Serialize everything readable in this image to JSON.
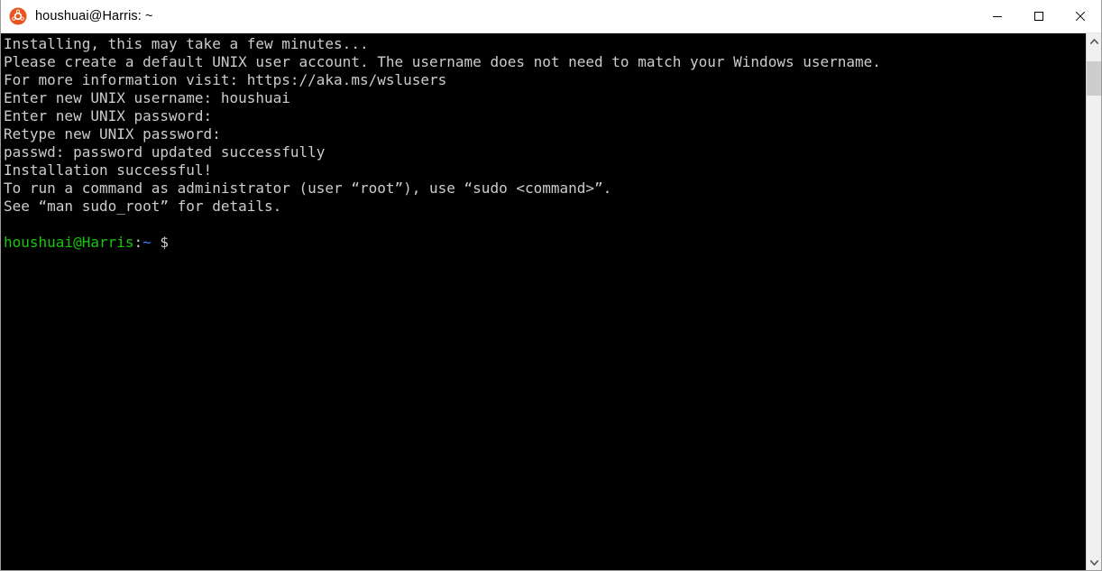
{
  "window": {
    "title": "houshuai@Harris: ~",
    "app_icon": "ubuntu-icon",
    "controls": {
      "minimize_label": "Minimize",
      "maximize_label": "Maximize",
      "close_label": "Close"
    }
  },
  "terminal": {
    "background_color": "#000000",
    "foreground_color": "#cccccc",
    "prompt_user_color": "#16c60c",
    "prompt_path_color": "#3b78ff",
    "lines": [
      "Installing, this may take a few minutes...",
      "Please create a default UNIX user account. The username does not need to match your Windows username.",
      "For more information visit: https://aka.ms/wslusers",
      "Enter new UNIX username: houshuai",
      "Enter new UNIX password:",
      "Retype new UNIX password:",
      "passwd: password updated successfully",
      "Installation successful!",
      "To run a command as administrator (user “root”), use “sudo <command>”.",
      "See “man sudo_root” for details.",
      ""
    ],
    "prompt": {
      "user_host": "houshuai@Harris",
      "separator": ":",
      "path": "~",
      "symbol": "$"
    }
  },
  "scrollbar": {
    "up_arrow_label": "scroll-up",
    "down_arrow_label": "scroll-down",
    "thumb_label": "scroll-thumb"
  }
}
